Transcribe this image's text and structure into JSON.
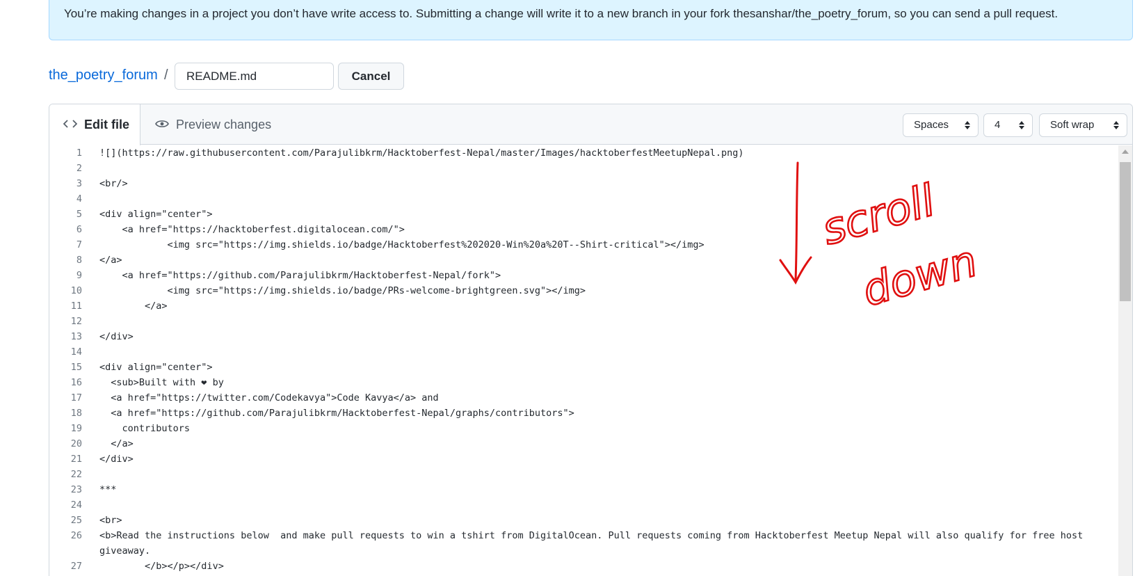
{
  "banner": {
    "text": "You’re making changes in a project you don’t have write access to. Submitting a change will write it to a new branch in your fork thesanshar/the_poetry_forum, so you can send a pull request."
  },
  "breadcrumb": {
    "repo": "the_poetry_forum",
    "separator": "/",
    "filename_value": "README.md",
    "cancel_label": "Cancel"
  },
  "editor": {
    "tabs": [
      {
        "label": "Edit file",
        "icon": "code-icon",
        "active": true
      },
      {
        "label": "Preview changes",
        "icon": "eye-icon",
        "active": false
      }
    ],
    "indent_mode": "Spaces",
    "indent_size": "4",
    "wrap_mode": "Soft wrap",
    "lines": [
      {
        "n": "1",
        "text": "![](https://raw.githubusercontent.com/Parajulibkrm/Hacktoberfest-Nepal/master/Images/hacktoberfestMeetupNepal.png)"
      },
      {
        "n": "2",
        "text": ""
      },
      {
        "n": "3",
        "text": "<br/>"
      },
      {
        "n": "4",
        "text": ""
      },
      {
        "n": "5",
        "text": "<div align=\"center\">"
      },
      {
        "n": "6",
        "text": "    <a href=\"https://hacktoberfest.digitalocean.com/\">"
      },
      {
        "n": "7",
        "text": "            <img src=\"https://img.shields.io/badge/Hacktoberfest%202020-Win%20a%20T--Shirt-critical\"></img>"
      },
      {
        "n": "8",
        "text": "</a>"
      },
      {
        "n": "9",
        "text": "    <a href=\"https://github.com/Parajulibkrm/Hacktoberfest-Nepal/fork\">"
      },
      {
        "n": "10",
        "text": "            <img src=\"https://img.shields.io/badge/PRs-welcome-brightgreen.svg\"></img>"
      },
      {
        "n": "11",
        "text": "        </a>"
      },
      {
        "n": "12",
        "text": ""
      },
      {
        "n": "13",
        "text": "</div>"
      },
      {
        "n": "14",
        "text": ""
      },
      {
        "n": "15",
        "text": "<div align=\"center\">"
      },
      {
        "n": "16",
        "text": "  <sub>Built with ❤ by"
      },
      {
        "n": "17",
        "text": "  <a href=\"https://twitter.com/Codekavya\">Code Kavya</a> and"
      },
      {
        "n": "18",
        "text": "  <a href=\"https://github.com/Parajulibkrm/Hacktoberfest-Nepal/graphs/contributors\">"
      },
      {
        "n": "19",
        "text": "    contributors"
      },
      {
        "n": "20",
        "text": "  </a>"
      },
      {
        "n": "21",
        "text": "</div>"
      },
      {
        "n": "22",
        "text": ""
      },
      {
        "n": "23",
        "text": "***"
      },
      {
        "n": "24",
        "text": ""
      },
      {
        "n": "25",
        "text": "<br>"
      },
      {
        "n": "26",
        "text": "<b>Read the instructions below  and make pull requests to win a tshirt from DigitalOcean. Pull requests coming from Hacktoberfest Meetup Nepal will also qualify for free host giveaway."
      },
      {
        "n": "27",
        "text": "        </b></p></div>"
      }
    ]
  },
  "annotation": {
    "word1": "scroll",
    "word2": "down",
    "color": "#e01010"
  }
}
